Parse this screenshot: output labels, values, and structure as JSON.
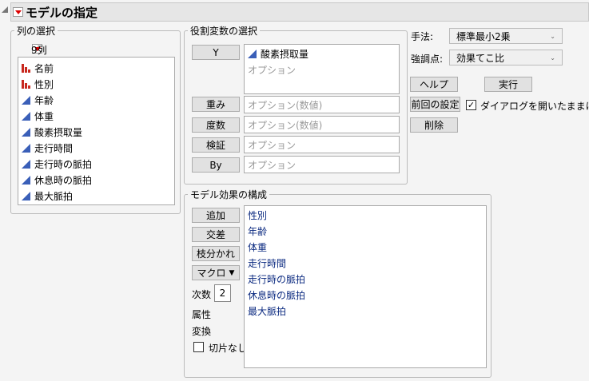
{
  "header": {
    "title": "モデルの指定"
  },
  "columns": {
    "title": "列の選択",
    "count": "9列",
    "items": [
      {
        "label": "名前",
        "type": "nominal"
      },
      {
        "label": "性別",
        "type": "nominal"
      },
      {
        "label": "年齢",
        "type": "continuous"
      },
      {
        "label": "体重",
        "type": "continuous"
      },
      {
        "label": "酸素摂取量",
        "type": "continuous"
      },
      {
        "label": "走行時間",
        "type": "continuous"
      },
      {
        "label": "走行時の脈拍",
        "type": "continuous"
      },
      {
        "label": "休息時の脈拍",
        "type": "continuous"
      },
      {
        "label": "最大脈拍",
        "type": "continuous"
      }
    ]
  },
  "roles": {
    "title": "役割変数の選択",
    "y": {
      "label": "Y",
      "value": "酸素摂取量",
      "placeholder": "オプション"
    },
    "weight": {
      "label": "重み",
      "placeholder": "オプション(数値)"
    },
    "freq": {
      "label": "度数",
      "placeholder": "オプション(数値)"
    },
    "validation": {
      "label": "検証",
      "placeholder": "オプション"
    },
    "by": {
      "label": "By",
      "placeholder": "オプション"
    }
  },
  "options": {
    "method_label": "手法:",
    "method_value": "標準最小2乗",
    "emphasis_label": "強調点:",
    "emphasis_value": "効果てこ比",
    "help": "ヘルプ",
    "run": "実行",
    "recall": "前回の設定",
    "remove": "削除",
    "keep_open": "ダイアログを開いたままにする",
    "keep_open_checked": true
  },
  "effects": {
    "title": "モデル効果の構成",
    "add": "追加",
    "cross": "交差",
    "nest": "枝分かれ",
    "macros": "マクロ",
    "degree_label": "次数",
    "degree": "2",
    "attributes": "属性",
    "transform": "変換",
    "no_intercept": "切片なし",
    "no_intercept_checked": false,
    "items": [
      "性別",
      "年齢",
      "体重",
      "走行時間",
      "走行時の脈拍",
      "休息時の脈拍",
      "最大脈拍"
    ]
  }
}
